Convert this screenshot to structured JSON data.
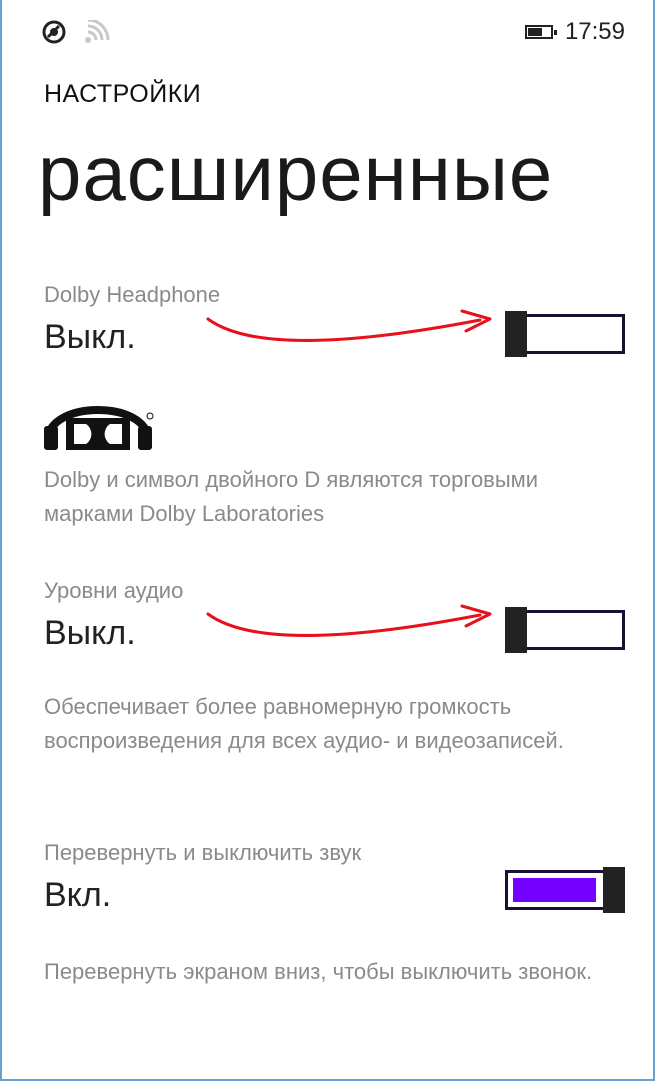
{
  "status_bar": {
    "time": "17:59",
    "icons": [
      "nfc-icon",
      "signal-icon",
      "battery-icon"
    ]
  },
  "header": {
    "app_title": "НАСТРОЙКИ",
    "page_title": "расширенные"
  },
  "settings": [
    {
      "label": "Dolby Headphone",
      "value": "Выкл.",
      "state": "off",
      "note": "Dolby и символ двойного D являются торговыми марками Dolby Laboratories"
    },
    {
      "label": "Уровни аудио",
      "value": "Выкл.",
      "state": "off",
      "description": "Обеспечивает более равномерную громкость воспроизведения для всех аудио- и видеозаписей."
    },
    {
      "label": "Перевернуть и выключить звук",
      "value": "Вкл.",
      "state": "on",
      "description": "Перевернуть экраном вниз, чтобы выключить звонок."
    }
  ],
  "colors": {
    "accent": "#7400ff",
    "annotation_arrow": "#e8101a",
    "label_gray": "#8a8a8a"
  }
}
